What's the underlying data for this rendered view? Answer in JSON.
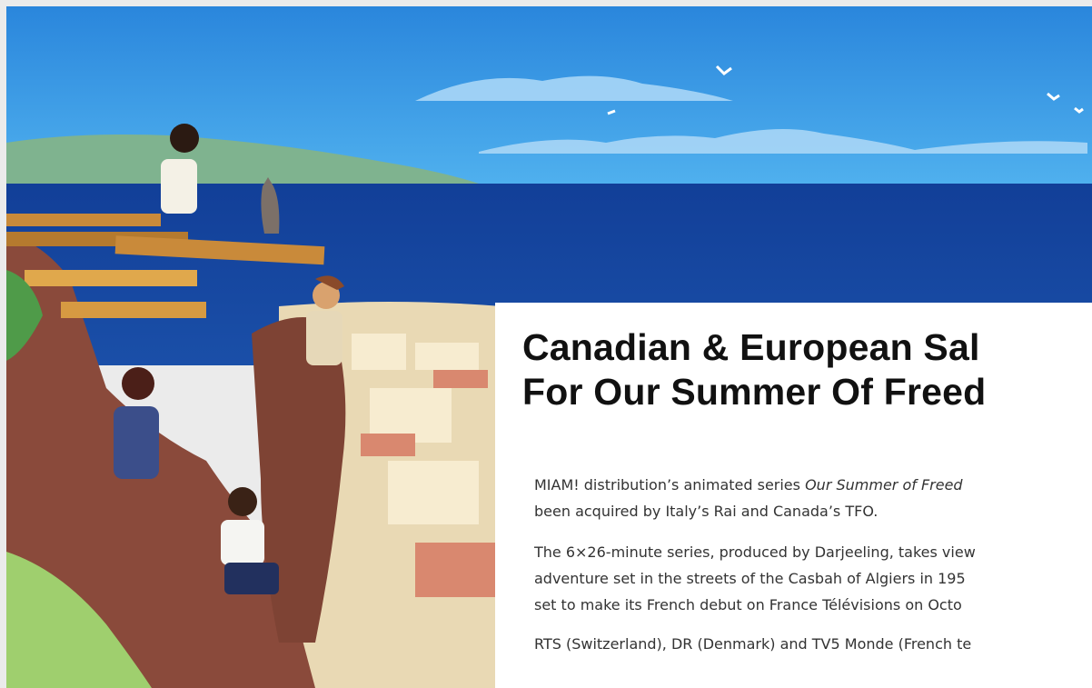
{
  "article": {
    "headline_line1": "Canadian & European Sal",
    "headline_line2": "For Our Summer Of Freed",
    "p1_line1_a": "MIAM! distribution’s animated series ",
    "p1_line1_em": "Our Summer of Freed",
    "p1_line2": "been acquired by Italy’s Rai and Canada’s TFO.",
    "p2_line1": "The 6×26-minute series, produced by Darjeeling, takes view",
    "p2_line2": "adventure set in the streets of the Casbah of Algiers in 195",
    "p2_line3": "set to make its French debut on France Télévisions on Octo",
    "p3_line1": "RTS (Switzerland), DR (Denmark) and TV5 Monde (French te"
  },
  "hero": {
    "image_name": "Our Summer of Freedom key art",
    "sky_color": "#2b8fe0",
    "sea_color": "#0f3f9a"
  }
}
